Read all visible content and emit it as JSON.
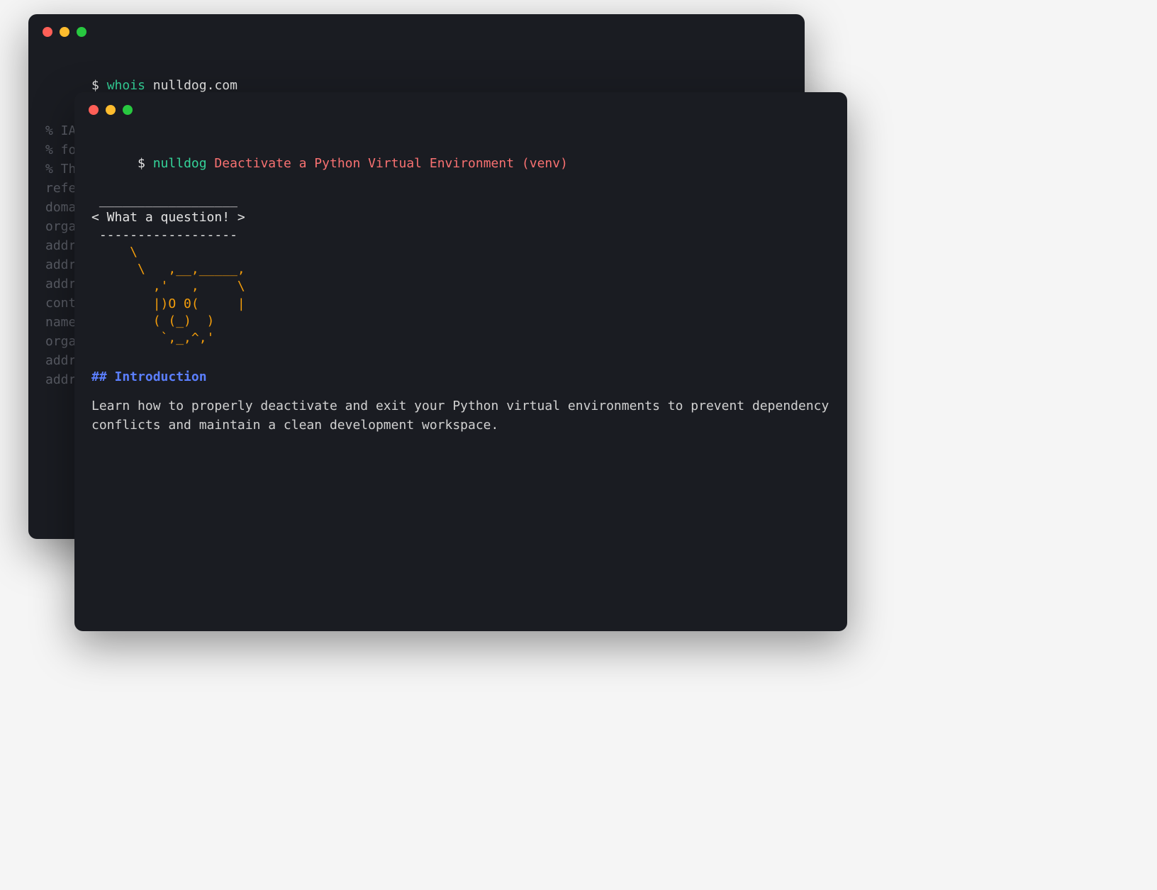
{
  "back_terminal": {
    "prompt": "$ ",
    "command": "whois",
    "args": "nulldog.com",
    "output": [
      "% IANA WHOIS server",
      "% for more information on IANA, visit http://www.iana.org",
      "% This query returned 1 object",
      "",
      "refer:        whois.verisign-grs.com",
      "",
      "domain:       COM",
      "",
      "organisation: VeriSign Global Registry Services",
      "address:      12061 Bluemont Way",
      "address:      Reston VA 20190",
      "address:      United States of America (the)",
      "",
      "contact:      administrative",
      "name:         Registry Customer Service",
      "organisation: VeriSign Global Registry Services",
      "address:      12061 Bluemont Way",
      "address:      Reston VA 20190"
    ]
  },
  "front_terminal": {
    "prompt": "$ ",
    "command": "nulldog",
    "args": "Deactivate a Python Virtual Environment (venv)",
    "speech": " __________________\n< What a question! >\n ------------------",
    "ascii_art": "     \\\n      \\   ,__,_____,\n        ,'   ,     \\\n        |)O 0(     |\n        ( (_)  )\n         `,_,^,'",
    "heading": "## Introduction",
    "body": "Learn how to properly deactivate and exit your Python virtual environments to prevent dependency conflicts and maintain a clean development workspace."
  }
}
